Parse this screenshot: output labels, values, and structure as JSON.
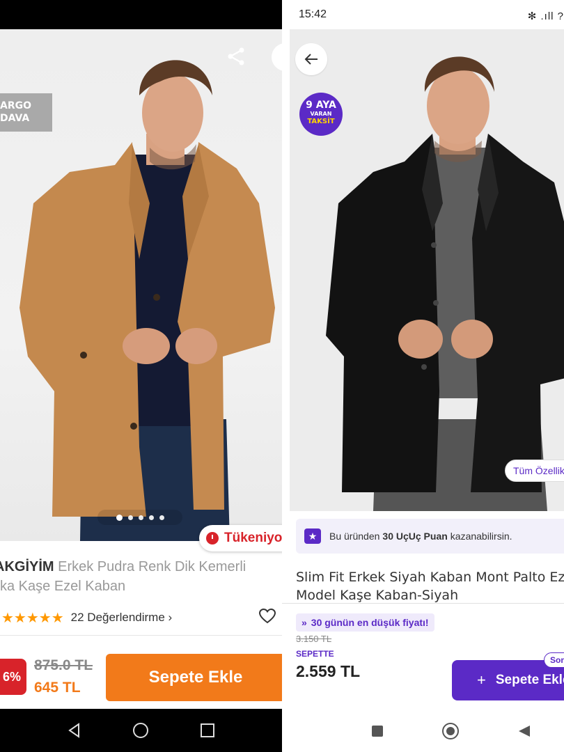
{
  "left_app": {
    "badge_cargo": [
      "ARGO",
      "DAVA"
    ],
    "badge_stock": "Tükeniyor",
    "brand": "AKGİYİM",
    "title_line1": "Erkek Pudra Renk Dik Kemerli",
    "title_line2": "ka Kaşe Ezel Kaban",
    "stars": "★★★★★",
    "rating_text": "22 Değerlendirme ›",
    "discount": "6%",
    "old_price": "875.0 TL",
    "new_price": "645 TL",
    "add_to_cart": "Sepete Ekle",
    "accent_color": "#f27a1a",
    "image_dots": {
      "count": 5,
      "active_index": 0
    }
  },
  "right_app": {
    "status_time": "15:42",
    "status_icons": "✻ .ıll ?",
    "taksit": {
      "line1": "9 AYA",
      "line2": "VARAN",
      "line3": "TAKSİT"
    },
    "all_features": "Tüm Özellikler",
    "points": {
      "prefix": "Bu üründen",
      "amount": "30 UçUç Puan",
      "suffix": "kazanabilirsin."
    },
    "title_line1": "Slim Fit Erkek Siyah Kaban Mont Palto Ezel",
    "title_line2": "Model Kaşe Kaban-Siyah",
    "lowest_price_badge": "30 günün en düşük fiyatı!",
    "old_price": "3.150 TL",
    "sepette_label": "SEPETTE",
    "price": "2.559 TL",
    "add_to_cart": "Sepete Ekle",
    "last_badge": "Son",
    "accent_color": "#5b2ac6",
    "image_dots": {
      "count": 5,
      "active_index": 0
    }
  }
}
